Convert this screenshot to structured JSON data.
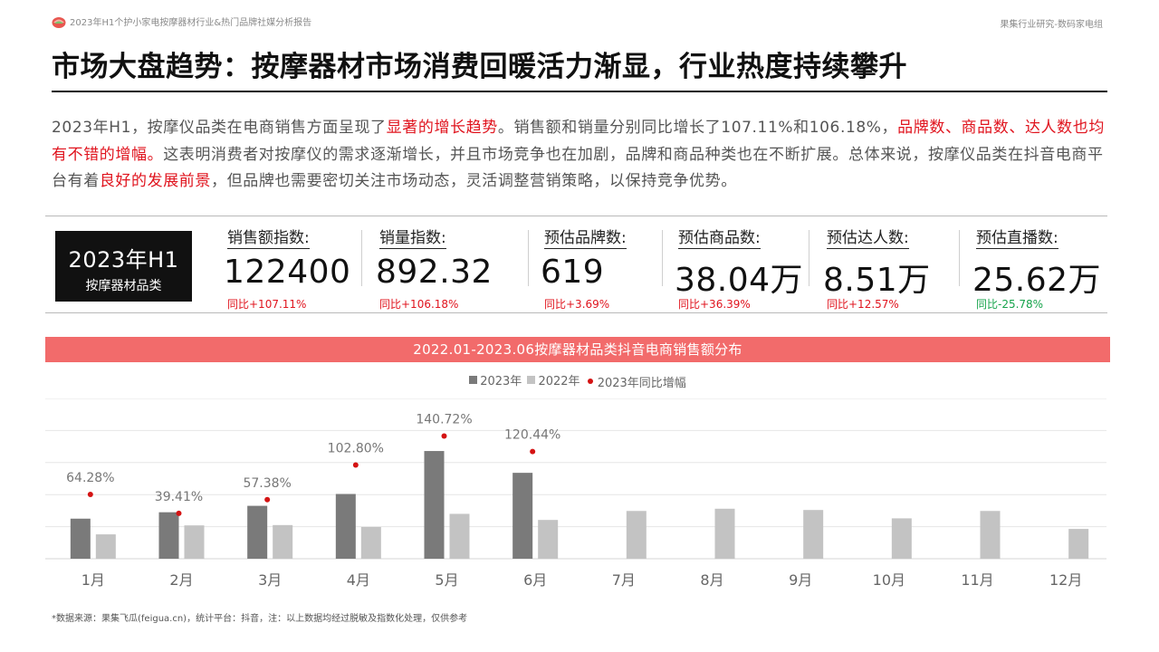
{
  "header": {
    "report_name": "2023年H1个护小家电按摩器材行业&热门品牌社媒分析报告",
    "brand": "果集行业研究-数码家电组",
    "title": "市场大盘趋势：按摩器材市场消费回暖活力渐显，行业热度持续攀升"
  },
  "intro": {
    "p1": "2023年H1，按摩仪品类在电商销售方面呈现了",
    "h1": "显著的增长趋势",
    "p2": "。销售额和销量分别同比增长了107.11%和106.18%，",
    "h2": "品牌数、商品数、达人数也均有不错的增幅。",
    "p3": "这表明消费者对按摩仪的需求逐渐增长，并且市场竞争也在加剧，品牌和商品种类也在不断扩展。总体来说，按摩仪品类在抖音电商平台有着",
    "h3": "良好的发展前景",
    "p4": "，但品牌也需要密切关注市场动态，灵活调整营销策略，以保持竞争优势。"
  },
  "kpi_badge": {
    "line1": "2023年H1",
    "line2": "按摩器材品类"
  },
  "kpis": [
    {
      "label": "销售额指数:",
      "value": "122400",
      "change": "同比+107.11%",
      "trend": "up"
    },
    {
      "label": "销量指数:",
      "value": "892.32",
      "change": "同比+106.18%",
      "trend": "up"
    },
    {
      "label": "预估品牌数:",
      "value": "619",
      "change": "同比+3.69%",
      "trend": "up"
    },
    {
      "label": "预估商品数:",
      "value": "38.04万",
      "change": "同比+36.39%",
      "trend": "up"
    },
    {
      "label": "预估达人数:",
      "value": "8.51万",
      "change": "同比+12.57%",
      "trend": "up"
    },
    {
      "label": "预估直播数:",
      "value": "25.62万",
      "change": "同比-25.78%",
      "trend": "down"
    }
  ],
  "colors": {
    "accent_red": "#e0141e",
    "banner": "#f26b6b",
    "bar_2023": "#7a7a7a",
    "bar_2022": "#c3c3c3",
    "dot": "#d41313",
    "down_green": "#15a34a"
  },
  "chart_data": {
    "type": "bar",
    "title": "2022.01-2023.06按摩器材品类抖音电商销售额分布",
    "categories": [
      "1月",
      "2月",
      "3月",
      "4月",
      "5月",
      "6月",
      "7月",
      "8月",
      "9月",
      "10月",
      "11月",
      "12月"
    ],
    "series": [
      {
        "name": "2023年",
        "type": "bar",
        "color": "#7a7a7a",
        "values": [
          12.5,
          14.5,
          16.5,
          20.2,
          33.6,
          26.8,
          null,
          null,
          null,
          null,
          null,
          null
        ]
      },
      {
        "name": "2022年",
        "type": "bar",
        "color": "#c3c3c3",
        "values": [
          7.6,
          10.4,
          10.5,
          9.9,
          14.0,
          12.1,
          14.9,
          15.6,
          15.2,
          12.6,
          14.9,
          9.3
        ]
      },
      {
        "name": "2023年同比增幅",
        "type": "scatter",
        "color": "#d41313",
        "values": [
          64.28,
          39.41,
          57.38,
          102.8,
          140.72,
          120.44,
          null,
          null,
          null,
          null,
          null,
          null
        ],
        "labels": [
          "64.28%",
          "39.41%",
          "57.38%",
          "102.80%",
          "140.72%",
          "120.44%"
        ]
      }
    ],
    "ylim": [
      0,
      50
    ],
    "growth_ylim": [
      -20,
      190
    ],
    "grid": true,
    "legend": "top-center"
  },
  "footnote": "*数据来源：果集飞瓜(feigua.cn)，统计平台：抖音，注：以上数据均经过脱敏及指数化处理，仅供参考"
}
